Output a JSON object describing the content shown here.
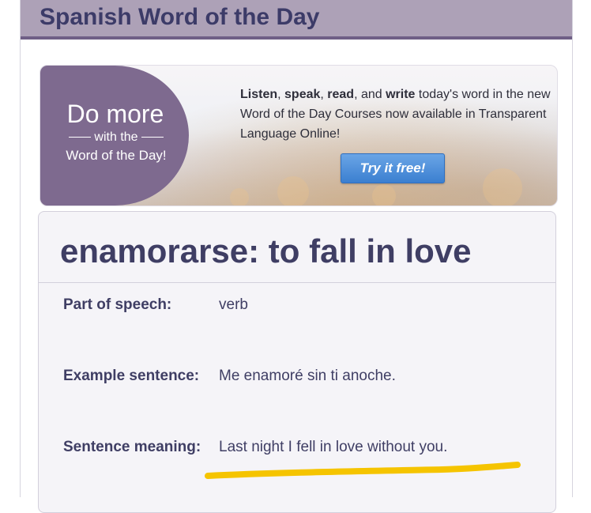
{
  "header": {
    "title": "Spanish Word of the Day"
  },
  "promo": {
    "do_more": "Do more",
    "with_the": "with the",
    "word_of_the_day": "Word of the Day!",
    "text_parts": [
      {
        "text": "Listen",
        "bold": true
      },
      {
        "text": ", ",
        "bold": false
      },
      {
        "text": "speak",
        "bold": true
      },
      {
        "text": ", ",
        "bold": false
      },
      {
        "text": "read",
        "bold": true
      },
      {
        "text": ", and ",
        "bold": false
      },
      {
        "text": "write",
        "bold": true
      },
      {
        "text": " today's word in the new Word of the Day Courses now available in Transparent Language Online!",
        "bold": false
      }
    ],
    "button_label": "Try it free!"
  },
  "word": {
    "title": "enamorarse: to fall in love",
    "rows": [
      {
        "label": "Part of speech:",
        "value": "verb"
      },
      {
        "label": "Example sentence:",
        "value": "Me enamoré sin ti anoche."
      },
      {
        "label": "Sentence meaning:",
        "value": "Last night I fell in love without you."
      }
    ]
  },
  "colors": {
    "header_bg": "#ada1b7",
    "header_border": "#6f5f86",
    "title_text": "#3c3b68",
    "promo_purple": "#7e6a8f",
    "button_blue": "#3b7fd0",
    "highlight": "#f5c400"
  }
}
